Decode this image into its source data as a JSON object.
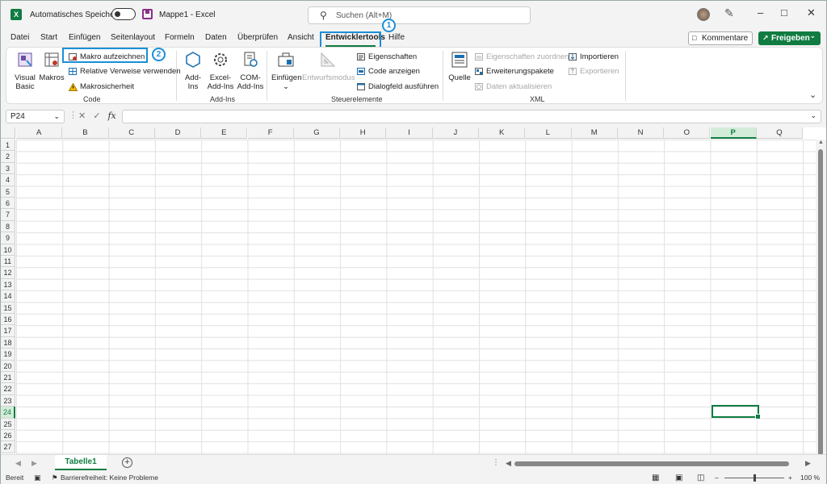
{
  "titlebar": {
    "autosave_label": "Automatisches Speichern",
    "doc_title": "Mappe1  -  Excel",
    "search_placeholder": "Suchen (Alt+M)",
    "logo": "X"
  },
  "tabs": [
    "Datei",
    "Start",
    "Einfügen",
    "Seitenlayout",
    "Formeln",
    "Daten",
    "Überprüfen",
    "Ansicht",
    "Entwicklertools",
    "Hilfe"
  ],
  "active_tab": "Entwicklertools",
  "buttons": {
    "comments": "Kommentare",
    "share": "Freigeben"
  },
  "annotations": {
    "one": "1",
    "two": "2"
  },
  "ribbon": {
    "code": {
      "label": "Code",
      "visual_basic_1": "Visual",
      "visual_basic_2": "Basic",
      "makros": "Makros",
      "record": "Makro aufzeichnen",
      "relative": "Relative Verweise verwenden",
      "security": "Makrosicherheit"
    },
    "addins": {
      "label": "Add-Ins",
      "addins_1": "Add-",
      "addins_2": "Ins",
      "excel_1": "Excel-",
      "excel_2": "Add-Ins",
      "com_1": "COM-",
      "com_2": "Add-Ins"
    },
    "controls": {
      "label": "Steuerelemente",
      "insert": "Einfügen",
      "design_mode": "Entwurfsmodus",
      "properties": "Eigenschaften",
      "view_code": "Code anzeigen",
      "run_dialog": "Dialogfeld ausführen"
    },
    "xml": {
      "label": "XML",
      "source": "Quelle",
      "map_props": "Eigenschaften zuordnen",
      "expansion": "Erweiterungspakete",
      "refresh": "Daten aktualisieren",
      "import": "Importieren",
      "export": "Exportieren"
    }
  },
  "formula": {
    "namebox": "P24",
    "fx": "fx"
  },
  "grid": {
    "columns": [
      "A",
      "B",
      "C",
      "D",
      "E",
      "F",
      "G",
      "H",
      "I",
      "J",
      "K",
      "L",
      "M",
      "N",
      "O",
      "P",
      "Q"
    ],
    "selected_column": "P",
    "selected_row": "24",
    "rows": [
      "1",
      "2",
      "3",
      "4",
      "5",
      "6",
      "7",
      "8",
      "9",
      "10",
      "11",
      "12",
      "13",
      "14",
      "15",
      "16",
      "17",
      "18",
      "19",
      "20",
      "21",
      "22",
      "23",
      "24",
      "25",
      "26",
      "27"
    ]
  },
  "sheets": {
    "active": "Tabelle1"
  },
  "status": {
    "ready": "Bereit",
    "accessibility": "Barrierefreiheit: Keine Probleme",
    "zoom": "100 %"
  },
  "colors": {
    "accent": "#107c41",
    "highlight": "#1a8fd6"
  }
}
